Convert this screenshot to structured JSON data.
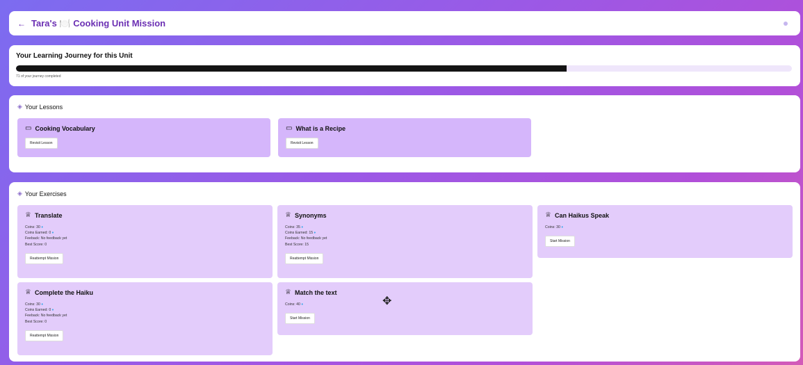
{
  "header": {
    "back_icon": "←",
    "title": "Tara's 🍽️ Cooking Unit Mission"
  },
  "journey": {
    "title": "Your Learning Journey for this Unit",
    "progress_percent": 71,
    "progress_label": "71 of your journey completed",
    "colors": {
      "fill": "#141414",
      "track": "#efe6fb"
    }
  },
  "lessons": {
    "heading": "Your Lessons",
    "items": [
      {
        "title": "Cooking Vocabulary",
        "button": "Revisit Lesson"
      },
      {
        "title": "What is a Recipe",
        "button": "Revisit Lesson"
      }
    ]
  },
  "exercises": {
    "heading": "Your Exercises",
    "items": [
      {
        "title": "Translate",
        "lines": [
          "Coins: 30",
          "Coins Earned: 0",
          "Feeback: No feedback yet",
          "Best Score: 0"
        ],
        "button": "Reattempt Mission"
      },
      {
        "title": "Synonyms",
        "lines": [
          "Coins: 35",
          "Coins Earned: 15",
          "Feeback: No feedback yet",
          "Best Score: 15"
        ],
        "button": "Reattempt Mission"
      },
      {
        "title": "Can Haikus Speak",
        "lines": [
          "Coins: 30"
        ],
        "button": "Start Mission"
      },
      {
        "title": "Complete the Haiku",
        "lines": [
          "Coins: 30",
          "Coins Earned: 0",
          "Feeback: No feedback yet",
          "Best Score: 0"
        ],
        "button": "Reattempt Mission"
      },
      {
        "title": "Match the text",
        "lines": [
          "Coins: 40"
        ],
        "button": "Start Mission"
      }
    ]
  },
  "icons": {
    "layers": "layers-icon",
    "book": "book-icon",
    "trophy": "trophy-icon",
    "gem": "gem-icon",
    "move": "move-cursor-icon"
  },
  "colors": {
    "accent": "#6b2fb3",
    "lesson_tile": "#d5b6fb",
    "exercise_tile": "#e3ccfb",
    "gem": "#38a7e8"
  }
}
